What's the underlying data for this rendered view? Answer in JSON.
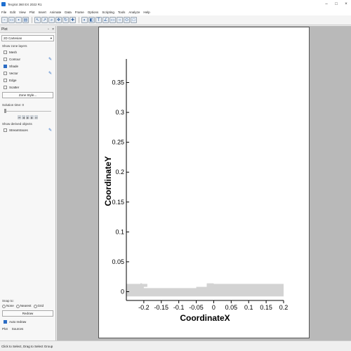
{
  "window": {
    "title": "Tecplot 360 EX 2022 R1"
  },
  "menu": [
    "File",
    "Edit",
    "View",
    "Plot",
    "Insert",
    "Animate",
    "Data",
    "Frame",
    "Options",
    "Scripting",
    "Tools",
    "Analyze",
    "Help"
  ],
  "toolbar_icons": [
    "new-icon",
    "open-icon",
    "save-icon",
    "print-icon",
    "select-icon",
    "adjust-icon",
    "zoom-icon",
    "translate-icon",
    "rotate-icon",
    "probe-icon",
    "contour-icon",
    "slice-icon",
    "text-icon",
    "geometry-icon",
    "rectangle-icon",
    "circle-icon",
    "ellipse-icon",
    "square-icon"
  ],
  "sidebar": {
    "title": "Plot",
    "plot_type": "2D Cartesian",
    "show_zone_layers_label": "Show zone layers",
    "layers": [
      {
        "label": "Mesh",
        "checked": false,
        "pin": false
      },
      {
        "label": "Contour",
        "checked": false,
        "pin": true
      },
      {
        "label": "Shade",
        "checked": true,
        "pin": false
      },
      {
        "label": "Vector",
        "checked": false,
        "pin": true
      },
      {
        "label": "Edge",
        "checked": false,
        "pin": false
      },
      {
        "label": "Scatter",
        "checked": false,
        "pin": false
      }
    ],
    "zone_style_button": "Zone Style...",
    "solution_time_label": "Solution time: 0",
    "show_derived_label": "Show derived objects",
    "streamtraces_label": "Streamtraces",
    "snap_to_label": "Snap to:",
    "snap_options": [
      "None",
      "Nearest",
      "Grid"
    ],
    "redraw_button": "Redraw",
    "auto_redraw_label": "Auto redraw",
    "bottom_tabs": [
      "Plot",
      "Sources"
    ]
  },
  "status": {
    "text": "Click to Select, Drag to Select Group"
  },
  "chart_data": {
    "type": "area",
    "xlabel": "CoordinateX",
    "ylabel": "CoordinateY",
    "xlim": [
      -0.25,
      0.2
    ],
    "ylim": [
      -0.01,
      0.38
    ],
    "xticks": [
      "-0.2",
      "-0.15",
      "-0.1",
      "-0.05",
      "0",
      "0.05",
      "0.1",
      "0.15",
      "0.2"
    ],
    "yticks": [
      "0",
      "0.05",
      "0.1",
      "0.15",
      "0.2",
      "0.25",
      "0.3",
      "0.35"
    ],
    "shade_color": "#d3d3d3",
    "series": [
      {
        "x": [
          -0.25,
          -0.21,
          -0.21,
          -0.205,
          -0.205,
          -0.19,
          -0.19,
          -0.2,
          -0.2,
          -0.05,
          -0.05,
          -0.02,
          -0.02,
          0.0,
          0.0,
          0.2,
          0.2,
          -0.25
        ],
        "y": [
          0.013,
          0.013,
          0.014,
          0.014,
          0.013,
          0.013,
          0.008,
          0.008,
          0.006,
          0.006,
          0.008,
          0.008,
          0.014,
          0.014,
          0.013,
          0.013,
          -0.008,
          -0.008
        ]
      }
    ]
  }
}
